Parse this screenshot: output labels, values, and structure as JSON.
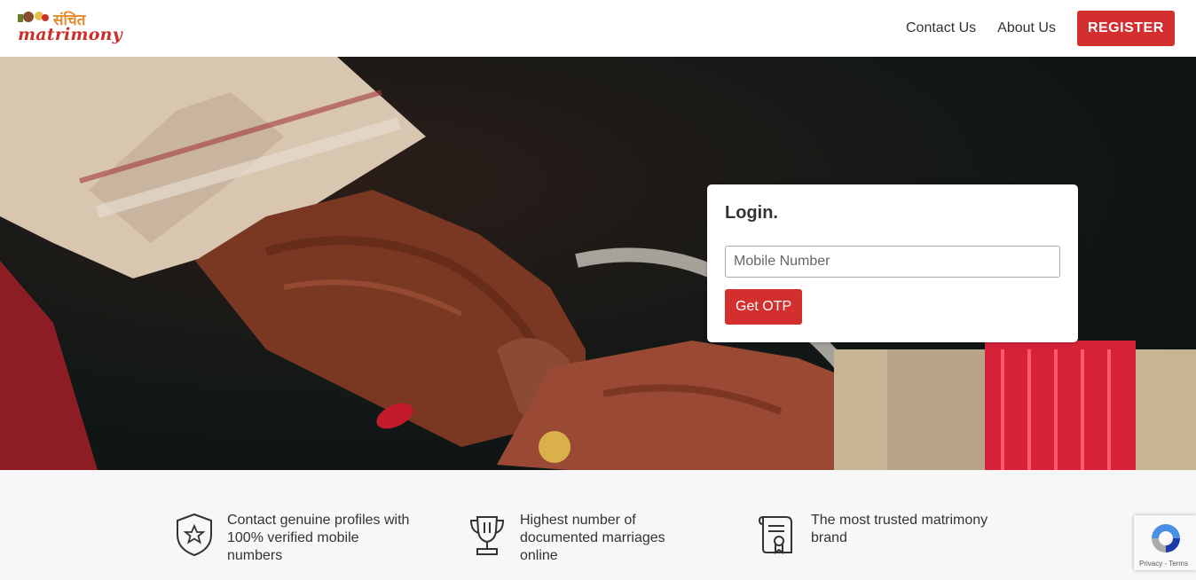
{
  "header": {
    "logo": {
      "hindi_text": "संचित",
      "word": "matrimony"
    },
    "nav": [
      {
        "label": "Contact Us"
      },
      {
        "label": "About Us"
      }
    ],
    "register_label": "REGISTER"
  },
  "login": {
    "title": "Login.",
    "mobile_placeholder": "Mobile Number",
    "mobile_value": "",
    "otp_label": "Get OTP"
  },
  "features": [
    {
      "icon": "shield-star-icon",
      "text_lines": [
        "Contact genuine profiles with",
        "100% verified mobile",
        "numbers"
      ]
    },
    {
      "icon": "trophy-icon",
      "text_lines": [
        "Highest number of",
        "documented marriages",
        "online"
      ]
    },
    {
      "icon": "certificate-icon",
      "text_lines": [
        "The most trusted matrimony",
        "brand"
      ]
    }
  ],
  "recaptcha": {
    "links": "Privacy - Terms"
  },
  "colors": {
    "accent": "#d32f2f",
    "text": "#333333",
    "features_bg": "#f7f7fa"
  }
}
